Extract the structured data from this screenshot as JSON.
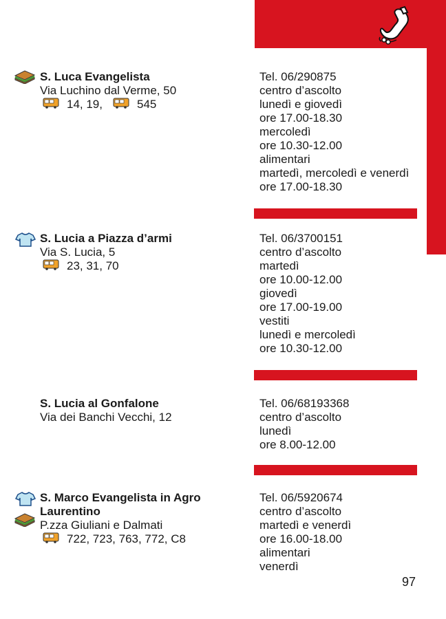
{
  "page_number": "97",
  "entries": [
    {
      "name": "S. Luca Evangelista",
      "address": "Via Luchino dal Verme, 50",
      "bus_a": "14, 19,",
      "bus_b": "545",
      "icons": [
        "sandwich-icon"
      ],
      "right": [
        "Tel. 06/290875",
        "centro d’ascolto",
        "lunedì e giovedì",
        "ore 17.00-18.30",
        "mercoledì",
        "ore 10.30-12.00",
        "alimentari",
        "martedì, mercoledì e venerdì",
        "ore 17.00-18.30"
      ]
    },
    {
      "name": "S. Lucia a Piazza d’armi",
      "address": "Via S. Lucia, 5",
      "bus_a": "23, 31, 70",
      "icons": [
        "tshirt-icon"
      ],
      "right": [
        "Tel. 06/3700151",
        "centro d’ascolto",
        "martedì",
        "ore 10.00-12.00",
        "giovedì",
        "ore 17.00-19.00",
        "vestiti",
        "lunedì e mercoledì",
        "ore 10.30-12.00"
      ]
    },
    {
      "name": "S. Lucia al Gonfalone",
      "address": "Via dei Banchi Vecchi, 12",
      "icons": [],
      "right": [
        "Tel. 06/68193368",
        "centro d’ascolto",
        "lunedì",
        "ore 8.00-12.00"
      ]
    },
    {
      "name_line1": "S. Marco Evangelista in Agro",
      "name_line2": "Laurentino",
      "address": "P.zza Giuliani e Dalmati",
      "bus_a": "722, 723, 763, 772, C8",
      "icons": [
        "tshirt-icon",
        "sandwich-icon"
      ],
      "right": [
        "Tel. 06/5920674",
        "centro d’ascolto",
        "martedì e venerdì",
        "ore 16.00-18.00",
        "alimentari",
        "venerdì"
      ]
    }
  ]
}
